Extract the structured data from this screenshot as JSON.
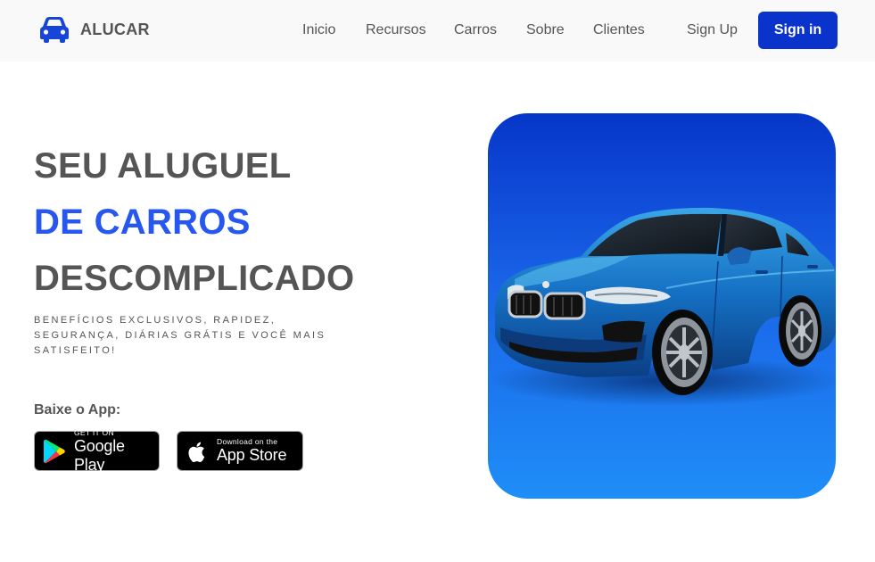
{
  "brand": {
    "name": "ALUCAR",
    "icon": "car-icon"
  },
  "nav": {
    "items": [
      {
        "label": "Inicio"
      },
      {
        "label": "Recursos"
      },
      {
        "label": "Carros"
      },
      {
        "label": "Sobre"
      },
      {
        "label": "Clientes"
      }
    ],
    "signup_label": "Sign Up",
    "signin_label": "Sign in"
  },
  "hero": {
    "line1": "SEU ALUGUEL",
    "line2": "DE CARROS",
    "line3": "DESCOMPLICADO",
    "subtitle": "Benefícios exclusivos, rapidez, segurança, diárias grátis e você mais satisfeito!",
    "app_label": "Baixe o App:"
  },
  "badges": {
    "google": {
      "small": "GET IT ON",
      "big": "Google Play",
      "icon": "google-play-icon"
    },
    "apple": {
      "small": "Download on the",
      "big": "App Store",
      "icon": "apple-icon"
    }
  },
  "colors": {
    "accent": "#2757ee",
    "button": "#0a33cc",
    "text": "#555555",
    "header_bg": "#f9f9f9",
    "card_top": "#0636c9",
    "card_bottom": "#1f8ef7"
  }
}
